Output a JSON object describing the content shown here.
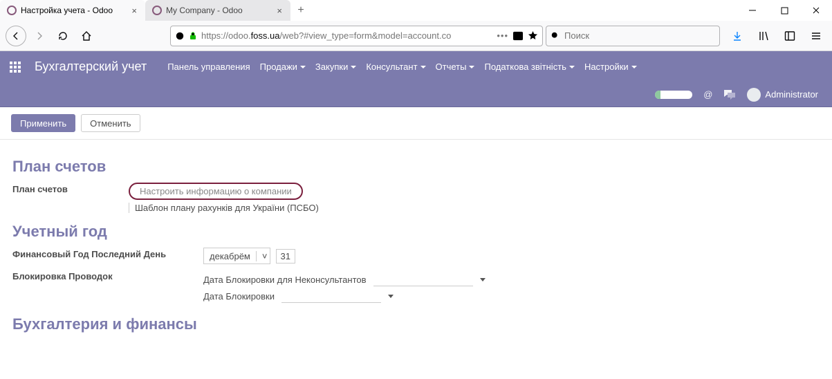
{
  "browser": {
    "tabs": [
      {
        "title": "Настройка учета - Odoo",
        "active": true
      },
      {
        "title": "My Company - Odoo",
        "active": false
      }
    ],
    "url_before": "https://odoo.",
    "url_domain": "foss.ua",
    "url_after": "/web?#view_type=form&model=account.co",
    "search_placeholder": "Поиск"
  },
  "nav": {
    "brand": "Бухгалтерский учет",
    "menu": [
      "Панель управления",
      "Продажи",
      "Закупки",
      "Консультант",
      "Отчеты",
      "Податкова звітність",
      "Настройки"
    ],
    "menu_has_caret": [
      false,
      true,
      true,
      true,
      true,
      true,
      true
    ],
    "user": "Administrator"
  },
  "actions": {
    "apply": "Применить",
    "cancel": "Отменить"
  },
  "sections": {
    "plan": {
      "title": "План счетов",
      "field_label": "План счетов",
      "company_link": "Настроить информацию о компании",
      "template": "Шаблон плану рахунків для України (ПСБО)"
    },
    "fy": {
      "title": "Учетный год",
      "last_day_label": "Финансовый Год Последний День",
      "month": "декабрём",
      "day": "31",
      "lock_label": "Блокировка Проводок",
      "lock1": "Дата Блокировки для Неконсультантов",
      "lock2": "Дата Блокировки"
    },
    "fin": {
      "title": "Бухгалтерия и финансы"
    }
  }
}
